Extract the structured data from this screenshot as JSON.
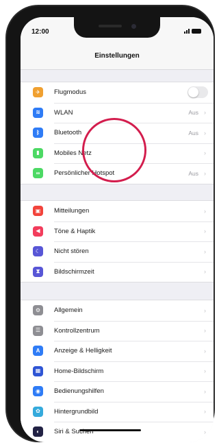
{
  "status": {
    "time": "12:00"
  },
  "nav": {
    "title": "Einstellungen"
  },
  "groups": [
    {
      "items": [
        {
          "label": "Flugmodus",
          "icon": "airplane-icon",
          "color": "#f0a030",
          "control": "toggle",
          "toggle_on": false
        },
        {
          "label": "WLAN",
          "icon": "wifi-icon",
          "color": "#2f7cf6",
          "value": "Aus"
        },
        {
          "label": "Bluetooth",
          "icon": "bluetooth-icon",
          "color": "#2f7cf6",
          "value": "Aus"
        },
        {
          "label": "Mobiles Netz",
          "icon": "cellular-icon",
          "color": "#4cd964"
        },
        {
          "label": "Persönlicher Hotspot",
          "icon": "hotspot-icon",
          "color": "#4cd964",
          "value": "Aus"
        }
      ]
    },
    {
      "items": [
        {
          "label": "Mitteilungen",
          "icon": "notifications-icon",
          "color": "#f2443c"
        },
        {
          "label": "Töne & Haptik",
          "icon": "sounds-icon",
          "color": "#f23d5c"
        },
        {
          "label": "Nicht stören",
          "icon": "moon-icon",
          "color": "#5856d6"
        },
        {
          "label": "Bildschirmzeit",
          "icon": "hourglass-icon",
          "color": "#5856d6"
        }
      ]
    },
    {
      "items": [
        {
          "label": "Allgemein",
          "icon": "gear-icon",
          "color": "#8e8e93"
        },
        {
          "label": "Kontrollzentrum",
          "icon": "control-center-icon",
          "color": "#8e8e93"
        },
        {
          "label": "Anzeige & Helligkeit",
          "icon": "display-icon",
          "color": "#2f7cf6"
        },
        {
          "label": "Home-Bildschirm",
          "icon": "home-screen-icon",
          "color": "#2f55d4"
        },
        {
          "label": "Bedienungshilfen",
          "icon": "accessibility-icon",
          "color": "#2f7cf6"
        },
        {
          "label": "Hintergrundbild",
          "icon": "wallpaper-icon",
          "color": "#35aadc"
        },
        {
          "label": "Siri & Suchen",
          "icon": "siri-icon",
          "color": "#222244"
        }
      ]
    }
  ]
}
